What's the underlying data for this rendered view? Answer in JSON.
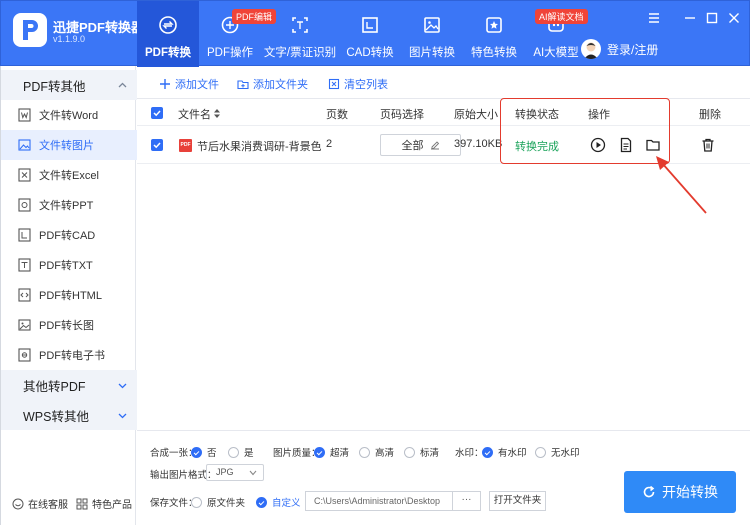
{
  "app": {
    "name": "迅捷PDF转换器",
    "version": "v1.1.9.0"
  },
  "colors": {
    "primary": "#3b76f6",
    "accent": "#2f6df6",
    "status_done": "#1aa35a",
    "badge": "#f04438",
    "highlight": "#e33b2e"
  },
  "nav": {
    "items": [
      {
        "label": "PDF转换",
        "icon": "pdf-convert-icon",
        "active": true
      },
      {
        "label": "PDF操作",
        "icon": "pdf-operation-icon",
        "badge": "PDF编辑"
      },
      {
        "label": "文字/票证识别",
        "icon": "ocr-icon"
      },
      {
        "label": "CAD转换",
        "icon": "cad-icon"
      },
      {
        "label": "图片转换",
        "icon": "image-icon"
      },
      {
        "label": "特色转换",
        "icon": "star-icon"
      },
      {
        "label": "AI大模型",
        "icon": "ai-icon",
        "badge": "AI解读文档"
      }
    ],
    "login": "登录/注册"
  },
  "sidebar": {
    "section1": "PDF转其他",
    "items": [
      {
        "label": "文件转Word",
        "icon": "word-icon"
      },
      {
        "label": "文件转图片",
        "icon": "picture-icon",
        "active": true
      },
      {
        "label": "文件转Excel",
        "icon": "excel-icon"
      },
      {
        "label": "文件转PPT",
        "icon": "ppt-icon"
      },
      {
        "label": "PDF转CAD",
        "icon": "cad-file-icon"
      },
      {
        "label": "PDF转TXT",
        "icon": "txt-icon"
      },
      {
        "label": "PDF转HTML",
        "icon": "html-icon"
      },
      {
        "label": "PDF转长图",
        "icon": "long-image-icon"
      },
      {
        "label": "PDF转电子书",
        "icon": "ebook-icon"
      }
    ],
    "section2": "其他转PDF",
    "section3": "WPS转其他",
    "footer_service": "在线客服",
    "footer_products": "特色产品"
  },
  "toolbar": {
    "add_file": "添加文件",
    "add_folder": "添加文件夹",
    "clear_list": "清空列表"
  },
  "table": {
    "headers": {
      "name": "文件名",
      "pages": "页数",
      "page_select": "页码选择",
      "size": "原始大小",
      "status": "转换状态",
      "ops": "操作",
      "delete": "删除"
    },
    "rows": [
      {
        "name": "节后水果消费调研-背景色.pc",
        "pages": "2",
        "page_select": "全部",
        "size": "397.10KB",
        "status": "转换完成"
      }
    ]
  },
  "options": {
    "merge_label": "合成一张：",
    "merge_no": "否",
    "merge_yes": "是",
    "quality_label": "图片质量：",
    "quality_super": "超清",
    "quality_high": "高清",
    "quality_std": "标清",
    "watermark_label": "水印：",
    "watermark_yes": "有水印",
    "watermark_no": "无水印",
    "format_label": "输出图片格式：",
    "format_value": "JPG",
    "save_label": "保存文件：",
    "save_original": "原文件夹",
    "save_custom": "自定义",
    "path": "C:\\Users\\Administrator\\Desktop",
    "browse": "···",
    "open_folder": "打开文件夹",
    "start": "开始转换"
  }
}
